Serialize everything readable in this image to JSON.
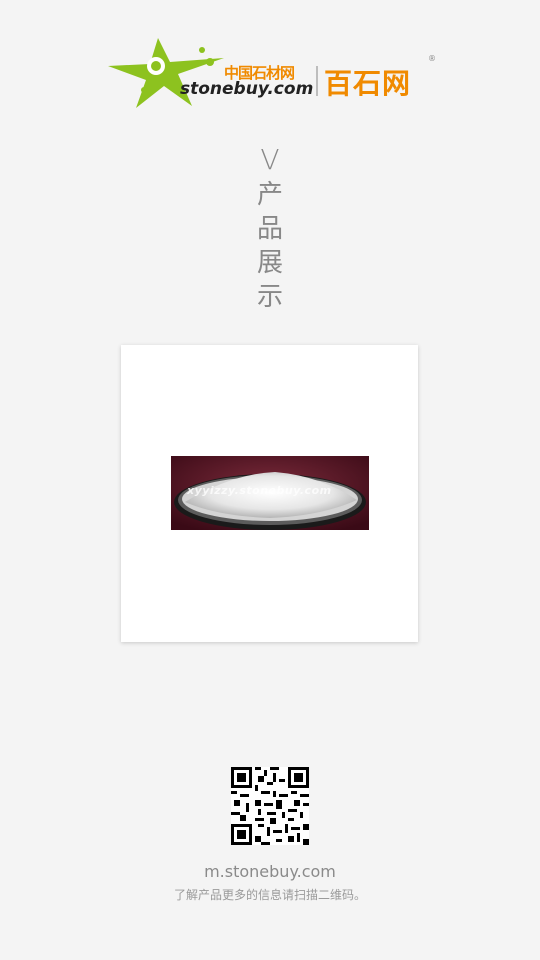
{
  "logo": {
    "cn_small": "中国石材网",
    "en": "stonebuy.com",
    "cn_big": "百石网",
    "reg": "®",
    "brand_green": "#8dc21f",
    "brand_orange": "#f08a00"
  },
  "section": {
    "v": "V",
    "chars": [
      "产",
      "品",
      "展",
      "示"
    ]
  },
  "product": {
    "watermark": "xyyizzy.stonebuy.com"
  },
  "footer": {
    "site": "m.stonebuy.com",
    "hint": "了解产品更多的信息请扫描二维码。"
  }
}
